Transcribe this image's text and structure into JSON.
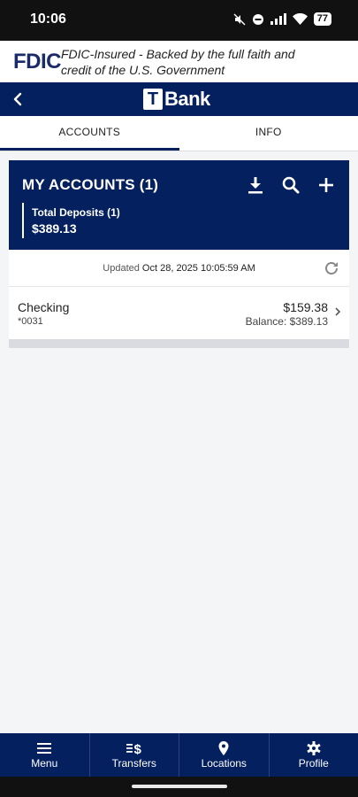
{
  "status_bar": {
    "time": "10:06",
    "battery": "77"
  },
  "fdic": {
    "logo": "FDIC",
    "text": "FDIC-Insured - Backed by the full faith and credit of the U.S. Government"
  },
  "header": {
    "brand_mark": "T",
    "brand_text": "Bank"
  },
  "tabs": [
    {
      "label": "ACCOUNTS",
      "active": true
    },
    {
      "label": "INFO",
      "active": false
    }
  ],
  "accounts_panel": {
    "title": "MY ACCOUNTS (1)",
    "actions": [
      "download-icon",
      "search-icon",
      "add-icon"
    ],
    "total_label": "Total Deposits (1)",
    "total_amount": "$389.13"
  },
  "updated": {
    "prefix": "Updated",
    "datetime": "Oct 28, 2025 10:05:59 AM"
  },
  "accounts": [
    {
      "name": "Checking",
      "number": "*0031",
      "amount": "$159.38",
      "balance": "Balance: $389.13"
    }
  ],
  "bottom_nav": [
    {
      "label": "Menu",
      "icon": "menu-icon"
    },
    {
      "label": "Transfers",
      "icon": "transfers-icon"
    },
    {
      "label": "Locations",
      "icon": "location-pin-icon"
    },
    {
      "label": "Profile",
      "icon": "gear-icon"
    }
  ],
  "colors": {
    "brand_navy": "#04205e",
    "background": "#f4f5f7"
  }
}
